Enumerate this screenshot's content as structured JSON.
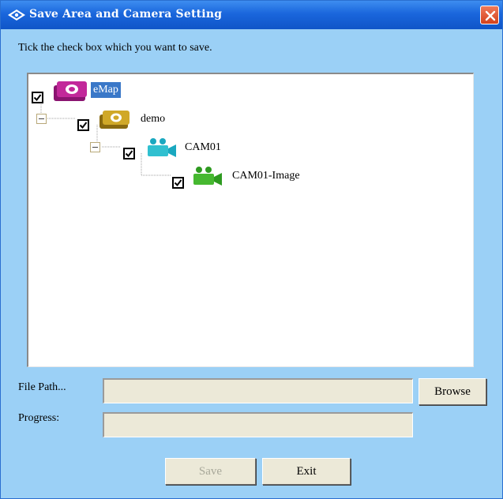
{
  "window": {
    "title": "Save Area and Camera Setting",
    "instruction": "Tick the check box which you want to save."
  },
  "tree": {
    "nodes": [
      {
        "label": "eMap",
        "icon": "emap-icon",
        "checked": true,
        "expanded": true,
        "selected": true,
        "color": "#b0208a"
      },
      {
        "label": "demo",
        "icon": "area-icon",
        "checked": true,
        "expanded": true,
        "selected": false,
        "color": "#c8a020"
      },
      {
        "label": "CAM01",
        "icon": "camera-icon",
        "checked": true,
        "expanded": true,
        "selected": false,
        "color": "#20b0c0"
      },
      {
        "label": "CAM01-Image",
        "icon": "camera-image-icon",
        "checked": true,
        "expanded": false,
        "selected": false,
        "color": "#40b030"
      }
    ]
  },
  "form": {
    "file_path_label": "File Path...",
    "file_path_value": "",
    "progress_label": "Progress:",
    "progress_value": "",
    "browse_label": "Browse"
  },
  "buttons": {
    "save_label": "Save",
    "exit_label": "Exit"
  },
  "colors": {
    "titlebar": "#1a66dc",
    "window_bg": "#9bd0f6",
    "selection": "#3a78c8",
    "close": "#d4421c"
  }
}
